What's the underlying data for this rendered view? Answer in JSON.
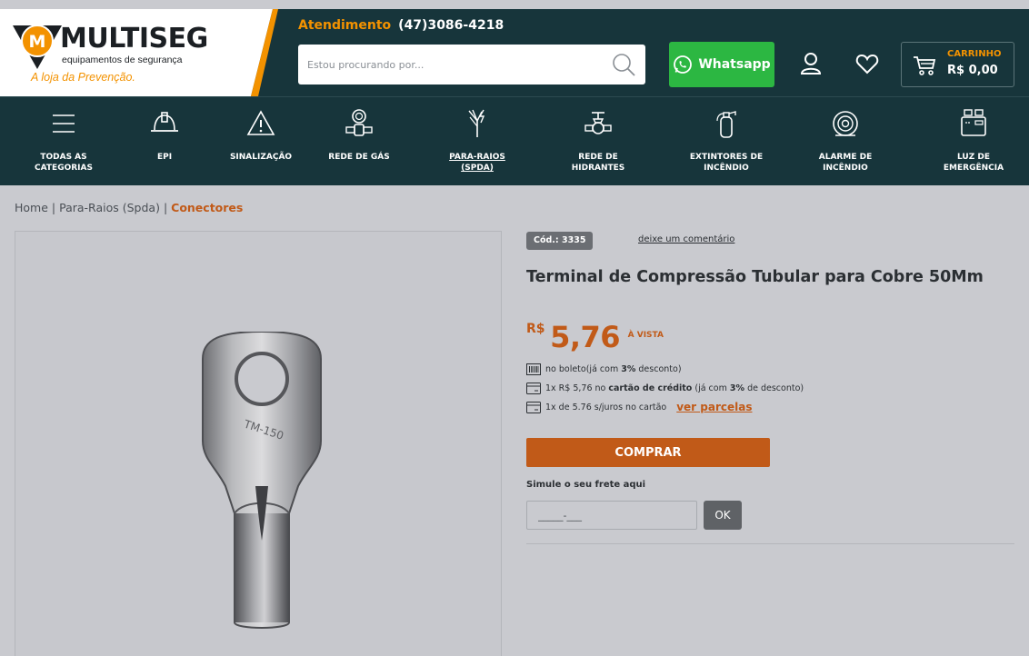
{
  "brand": {
    "name": "MULTISEG",
    "subtitle": "equipamentos de segurança",
    "tagline": "A loja da Prevenção.",
    "primary_color": "#17353b",
    "accent_color": "#f39200"
  },
  "header": {
    "atendimento_label": "Atendimento",
    "phone": "(47)3086-4218",
    "search_placeholder": "Estou procurando por...",
    "whatsapp_label": "Whatsapp",
    "cart_label": "CARRINHO",
    "cart_value": "R$ 0,00",
    "icons": [
      "search-icon",
      "whatsapp-icon",
      "user-icon",
      "heart-icon",
      "cart-icon"
    ]
  },
  "nav": {
    "items": [
      {
        "label_line1": "TODAS AS",
        "label_line2": "CATEGORIAS",
        "icon": "menu-icon"
      },
      {
        "label_line1": "EPI",
        "label_line2": "",
        "icon": "helmet-icon"
      },
      {
        "label_line1": "SINALIZAÇÃO",
        "label_line2": "",
        "icon": "warning-triangle-icon"
      },
      {
        "label_line1": "REDE DE GÁS",
        "label_line2": "",
        "icon": "gas-meter-icon"
      },
      {
        "label_line1": "PARA-RAIOS",
        "label_line2": "(SPDA)",
        "icon": "lightning-rod-icon",
        "active": true
      },
      {
        "label_line1": "REDE DE",
        "label_line2": "HIDRANTES",
        "icon": "hydrant-valve-icon"
      },
      {
        "label_line1": "EXTINTORES DE",
        "label_line2": "INCÊNDIO",
        "icon": "fire-extinguisher-icon"
      },
      {
        "label_line1": "ALARME DE",
        "label_line2": "INCÊNDIO",
        "icon": "fire-alarm-icon"
      },
      {
        "label_line1": "LUZ DE",
        "label_line2": "EMERGÊNCIA",
        "icon": "emergency-light-icon"
      }
    ]
  },
  "breadcrumb": {
    "home": "Home",
    "separator": "|",
    "category": "Para-Raios (Spda)",
    "current": "Conectores"
  },
  "product": {
    "code": "Cód.: 3335",
    "comment_link": "deixe um comentário",
    "title": "Terminal de Compressão Tubular para Cobre 50Mm",
    "price_currency": "R$",
    "price_value": "5,76",
    "price_note": "À VISTA",
    "image_text": "TM-150",
    "payment": {
      "boleto_text": "no boleto(já com",
      "boleto_pct": "3%",
      "boleto_suffix": "desconto)",
      "credit_prefix": "1x R$ 5,76 no",
      "credit_bold": "cartão de crédito",
      "credit_mid": "(já com",
      "credit_pct": "3%",
      "credit_suffix": "de desconto)",
      "installments_text": "1x de 5.76 s/juros no cartão",
      "installments_link": "ver parcelas"
    },
    "buy_label": "COMPRAR",
    "shipping_label": "Simule o seu frete aqui",
    "shipping_placeholder": "_____-___",
    "ok_label": "OK",
    "price_color": "#c15a18"
  }
}
